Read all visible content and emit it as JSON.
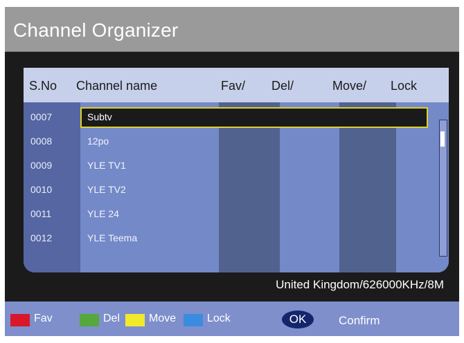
{
  "title": "Channel Organizer",
  "table": {
    "headers": {
      "sno": "S.No",
      "name": "Channel name",
      "fav": "Fav/",
      "del": "Del/",
      "move": "Move/",
      "lock": "Lock"
    },
    "rows": [
      {
        "sno": "0007",
        "name": "Subtv",
        "selected": true
      },
      {
        "sno": "0008",
        "name": "12po"
      },
      {
        "sno": "0009",
        "name": "YLE TV1"
      },
      {
        "sno": "0010",
        "name": "YLE TV2"
      },
      {
        "sno": "0011",
        "name": "YLE 24"
      },
      {
        "sno": "0012",
        "name": "YLE Teema"
      }
    ]
  },
  "status": {
    "frequency": "United Kingdom/626000KHz/8M"
  },
  "footer": {
    "fav_label": "Fav",
    "del_label": "Del",
    "move_label": "Move",
    "lock_label": "Lock",
    "ok_label": "OK",
    "confirm_label": "Confirm"
  },
  "colors": {
    "fav": "#d9172a",
    "del": "#56a83c",
    "move": "#f0ea2b",
    "lock": "#3b8be0",
    "highlight_border": "#ddd22a"
  }
}
